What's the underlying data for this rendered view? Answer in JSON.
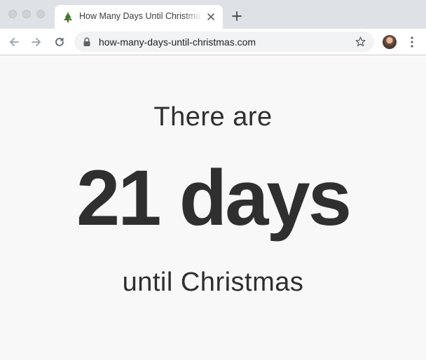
{
  "browser": {
    "tab": {
      "title": "How Many Days Until Christmas",
      "favicon": "christmas-tree-icon"
    },
    "omnibox": {
      "url": "how-many-days-until-christmas.com"
    },
    "icons": {
      "back": "arrow-left-icon",
      "forward": "arrow-right-icon",
      "reload": "reload-icon",
      "lock": "lock-icon",
      "bookmark": "star-icon",
      "menu": "kebab-menu-icon",
      "new_tab": "plus-icon",
      "close_tab": "close-icon"
    }
  },
  "page": {
    "lead": "There are",
    "count": "21 days",
    "tail": "until Christmas"
  },
  "colors": {
    "text": "#2f2f2f",
    "page_background": "#f8f8f8",
    "tabstrip": "#dee1e6",
    "omnibox": "#f1f3f4"
  }
}
